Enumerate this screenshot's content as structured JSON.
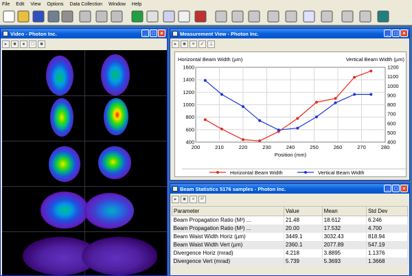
{
  "menu": [
    "File",
    "Edit",
    "View",
    "Options",
    "Data Collection",
    "Window",
    "Help"
  ],
  "toolbar_icons": [
    "new-file-icon",
    "open-folder-icon",
    "save-icon",
    "print-icon",
    "help-cursor-icon",
    "graph-disabled-icon",
    "cursor-disabled-icon",
    "play-disabled-icon",
    "calibrate-icon",
    "capture-icon",
    "beam-profile-icon",
    "snapshot-icon",
    "camera-icon",
    "waveform-icon",
    "profile-chart-icon",
    "chart2-icon",
    "chart3-icon",
    "histogram-icon",
    "statistics-chart-icon",
    "spot-icon",
    "scatter-icon",
    "table-icon",
    "export-chart-icon"
  ],
  "video": {
    "title": "Video - Photon Inc."
  },
  "measurement": {
    "title": "Measurement View - Photon Inc."
  },
  "stats": {
    "title": "Beam Statistics 5176 samples - Photon Inc.",
    "columns": [
      "Parameter",
      "Value",
      "Mean",
      "Std Dev"
    ],
    "rows": [
      [
        "Beam Propagation Ratio (M²) ...",
        "21.48",
        "18.612",
        "6.246"
      ],
      [
        "Beam Propagation Ratio (M²) ...",
        "20.00",
        "17.532",
        "4.700"
      ],
      [
        "Beam Waist Width Horiz (µm)",
        "3449.1",
        "3032.43",
        "818.94"
      ],
      [
        "Beam Waist Width Vert (µm)",
        "2360.1",
        "2077.89",
        "547.19"
      ],
      [
        "Divergence Horiz (mrad)",
        "4.218",
        "3.8895",
        "1.1376"
      ],
      [
        "Divergence Vert (mrad)",
        "5.739",
        "5.3693",
        "1.3668"
      ]
    ]
  },
  "chart_data": {
    "type": "line",
    "ylabel_left": "Horizontal Beam Width (µm)",
    "ylabel_right": "Vertical Beam Width (µm)",
    "xlabel": "Position (mm)",
    "xlim": [
      200,
      280
    ],
    "ylim_left": [
      400,
      1600
    ],
    "ylim_right": [
      400,
      1200
    ],
    "x_ticks": [
      200,
      210,
      220,
      230,
      240,
      250,
      260,
      270,
      280
    ],
    "y_ticks_left": [
      400,
      600,
      800,
      1000,
      1200,
      1400,
      1600
    ],
    "y_ticks_right": [
      400,
      500,
      600,
      700,
      800,
      900,
      1000,
      1100,
      1200
    ],
    "series": [
      {
        "name": "Horizontal Beam Width",
        "color": "#e8281c",
        "axis": "left",
        "x": [
          204,
          211,
          220,
          227,
          235,
          243,
          251,
          259,
          267,
          274
        ],
        "y": [
          760,
          610,
          440,
          420,
          570,
          780,
          1040,
          1100,
          1440,
          1540
        ]
      },
      {
        "name": "Vertical Beam Width",
        "color": "#1c34d8",
        "axis": "right",
        "x": [
          204,
          211,
          220,
          227,
          235,
          243,
          251,
          259,
          267,
          274
        ],
        "y": [
          1060,
          910,
          780,
          630,
          530,
          550,
          670,
          820,
          910,
          910
        ]
      }
    ],
    "legend_position": "bottom",
    "grid": true
  }
}
